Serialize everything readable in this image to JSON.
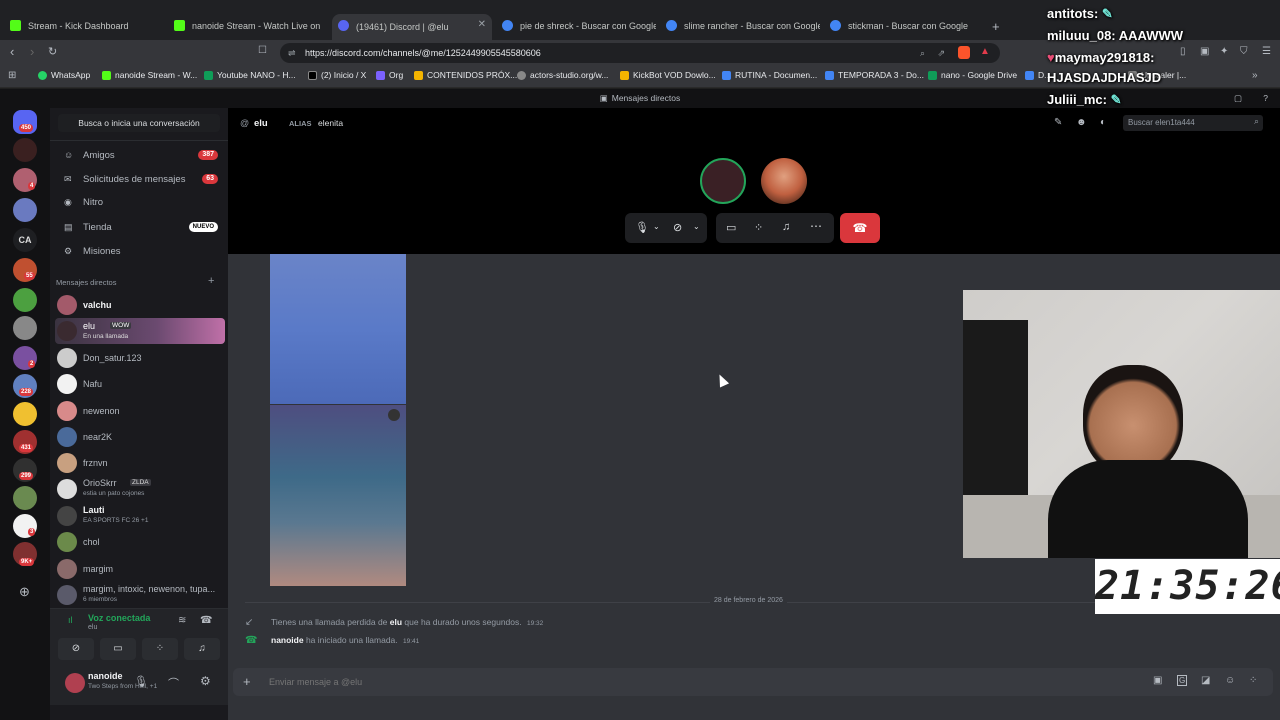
{
  "browser": {
    "tabs": [
      {
        "label": "Stream - Kick Dashboard",
        "color": "#53fc18"
      },
      {
        "label": "nanoide Stream - Watch Live on",
        "color": "#53fc18"
      },
      {
        "label": "(19461) Discord | @elu",
        "color": "#5865f2"
      },
      {
        "label": "pie de shreck - Buscar con Google",
        "color": "#4285f4"
      },
      {
        "label": "slime rancher - Buscar con Google",
        "color": "#4285f4"
      },
      {
        "label": "stickman - Buscar con Google",
        "color": "#4285f4"
      }
    ],
    "url": "https://discord.com/channels/@me/1252449905545580606",
    "bookmarks": [
      {
        "label": "WhatsApp",
        "color": "#25d366"
      },
      {
        "label": "nanoide Stream - W...",
        "color": "#53fc18"
      },
      {
        "label": "Youtube NANO - H...",
        "color": "#0f9d58"
      },
      {
        "label": "(2) Inicio / X",
        "color": "#000000"
      },
      {
        "label": "Org",
        "color": "#7b61ff"
      },
      {
        "label": "CONTENIDOS PRÓX...",
        "color": "#f4b400"
      },
      {
        "label": "actors-studio.org/w...",
        "color": "#888888"
      },
      {
        "label": "KickBot VOD Dowlo...",
        "color": "#f4b400"
      },
      {
        "label": "RUTINA - Documen...",
        "color": "#4285f4"
      },
      {
        "label": "TEMPORADA 3 - Do...",
        "color": "#4285f4"
      },
      {
        "label": "nano - Google Drive",
        "color": "#0f9d58"
      },
      {
        "label": "D...",
        "color": "#4285f4"
      },
      {
        "label": "Upscaler |...",
        "color": "#888888"
      }
    ]
  },
  "stream_chat": [
    {
      "user": "antitots:",
      "msg": ""
    },
    {
      "user": "miluuu_08:",
      "msg": "AAAWWW"
    },
    {
      "user": "maymay291818:",
      "msg": ""
    },
    {
      "user": "",
      "msg": "HJASDAJDHASJD"
    },
    {
      "user": "Juliii_mc:",
      "msg": ""
    }
  ],
  "clock": "21:35:26",
  "discord": {
    "top_title": "Mensajes directos",
    "search_placeholder": "Busca o inicia una conversación",
    "nav": [
      {
        "label": "Amigos",
        "count": "387",
        "icon": "friends-icon"
      },
      {
        "label": "Solicitudes de mensajes",
        "count": "63",
        "icon": "mail-icon"
      },
      {
        "label": "Nitro",
        "count": "",
        "icon": "nitro-icon"
      },
      {
        "label": "Tienda",
        "count": "NUEVO",
        "icon": "shop-icon"
      },
      {
        "label": "Misiones",
        "count": "",
        "icon": "quest-icon"
      }
    ],
    "dm_header": "Mensajes directos",
    "dms": [
      {
        "name": "valchu",
        "sub": "",
        "color": "#a35a6a"
      },
      {
        "name": "elu",
        "sub": "En una llamada",
        "color": "#3a2a30",
        "tag": "WOW"
      },
      {
        "name": "Don_satur.123",
        "sub": "",
        "color": "#cccccc"
      },
      {
        "name": "Nafu",
        "sub": "",
        "color": "#f2f2f2"
      },
      {
        "name": "newenon",
        "sub": "",
        "color": "#d88a8a"
      },
      {
        "name": "near2K",
        "sub": "",
        "color": "#4a6a9a"
      },
      {
        "name": "frznvn",
        "sub": "",
        "color": "#c8a080"
      },
      {
        "name": "OrioSkrr",
        "sub": "estia un pato cojones",
        "color": "#dddddd",
        "tag": "ZLDA"
      },
      {
        "name": "Lauti",
        "sub": "EA SPORTS FC 26 +1",
        "color": "#444444"
      },
      {
        "name": "chol",
        "sub": "",
        "color": "#6b8a4a"
      },
      {
        "name": "margim",
        "sub": "",
        "color": "#8a6a6a"
      },
      {
        "name": "margim, intoxic, newenon, tupa...",
        "sub": "6 miembros",
        "color": "#5a5a6a"
      }
    ],
    "server_badges": [
      "450",
      "",
      "4",
      "",
      "",
      "55",
      "",
      "",
      "2",
      "228",
      "",
      "431",
      "299",
      "",
      "3",
      "9K+"
    ],
    "voice": {
      "status": "Voz conectada",
      "channel": "elu"
    },
    "user": {
      "name": "nanoide",
      "status": "Two Steps from Hell, +1"
    },
    "channel": {
      "name": "elu",
      "alias_label": "ALIAS",
      "alias": "elenita",
      "search_placeholder": "Buscar elen1ta444"
    },
    "date_divider": "28 de febrero de 2026",
    "messages": [
      {
        "pre": "Tienes una llamada perdida de ",
        "bold": "elu",
        "post": " que ha durado unos segundos.",
        "time": "19:32"
      },
      {
        "pre": "",
        "bold": "nanoide",
        "post": " ha iniciado una llamada.",
        "time": "19:41"
      }
    ],
    "chat_placeholder": "Enviar mensaje a @elu"
  }
}
